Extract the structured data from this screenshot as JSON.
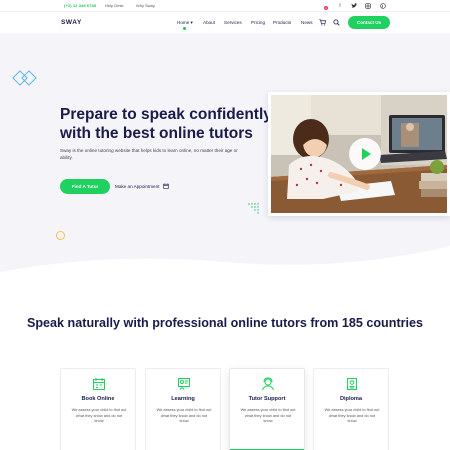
{
  "topbar": {
    "phone": "(+2) 12 345 6789",
    "links": [
      "Help Desk",
      "Why Sway"
    ],
    "social": [
      "facebook-icon",
      "twitter-icon",
      "instagram-icon",
      "pinterest-icon"
    ]
  },
  "header": {
    "logo": "SWAY",
    "nav": [
      "Home",
      "About",
      "Services",
      "Pricing",
      "Products",
      "News"
    ],
    "nav_active": "Home",
    "cart_count": "1",
    "contact_label": "Contact Us"
  },
  "hero": {
    "title": "Prepare to speak confidently with the best online tutors",
    "description": "Sway is the online tutoring website that helps kids to learn online, no matter their age or ability.",
    "primary_button": "Find A Tutor",
    "secondary_link": "Make an Appointment"
  },
  "section": {
    "title": "Speak naturally with professional online tutors from 185 countries"
  },
  "cards": [
    {
      "title": "Book Online",
      "desc": "We assess your child to find out what they know and do not know",
      "icon": "calendar-icon"
    },
    {
      "title": "Learning",
      "desc": "We assess your child to find out what they know and do not know",
      "icon": "presentation-icon"
    },
    {
      "title": "Tutor Support",
      "desc": "We assess your child to find out what they know and do not know",
      "icon": "support-icon"
    },
    {
      "title": "Diploma",
      "desc": "We assess your child to find out what they know and do not know",
      "icon": "diploma-icon"
    }
  ],
  "colors": {
    "accent": "#1fd15f",
    "navy": "#1a1a4b",
    "hero_bg": "#f4f4f9",
    "badge": "#e83b5c"
  }
}
